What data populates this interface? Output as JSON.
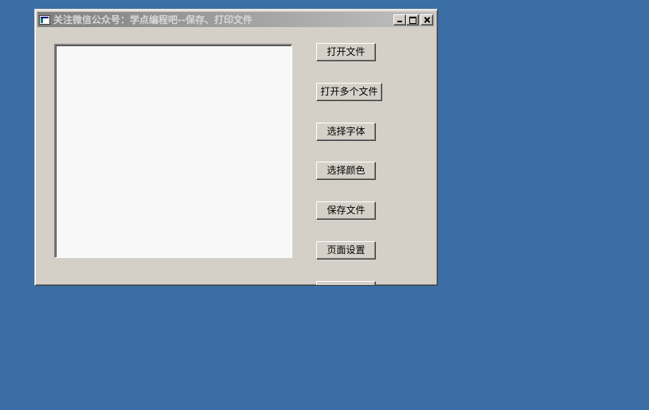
{
  "window": {
    "title": "关注微信公众号：学点编程吧--保存、打印文件"
  },
  "titlebar": {
    "icon": "app-window-icon",
    "controls": [
      "minimize-icon",
      "maximize-icon",
      "close-icon"
    ]
  },
  "buttons": {
    "open_file": "打开文件",
    "open_multiple_files": "打开多个文件",
    "choose_font": "选择字体",
    "choose_color": "选择颜色",
    "save_file": "保存文件",
    "page_setup": "页面设置"
  },
  "colors": {
    "desktop": "#3a6ea5",
    "window_face": "#d4d0c8",
    "text_area": "#f8f8f8"
  }
}
